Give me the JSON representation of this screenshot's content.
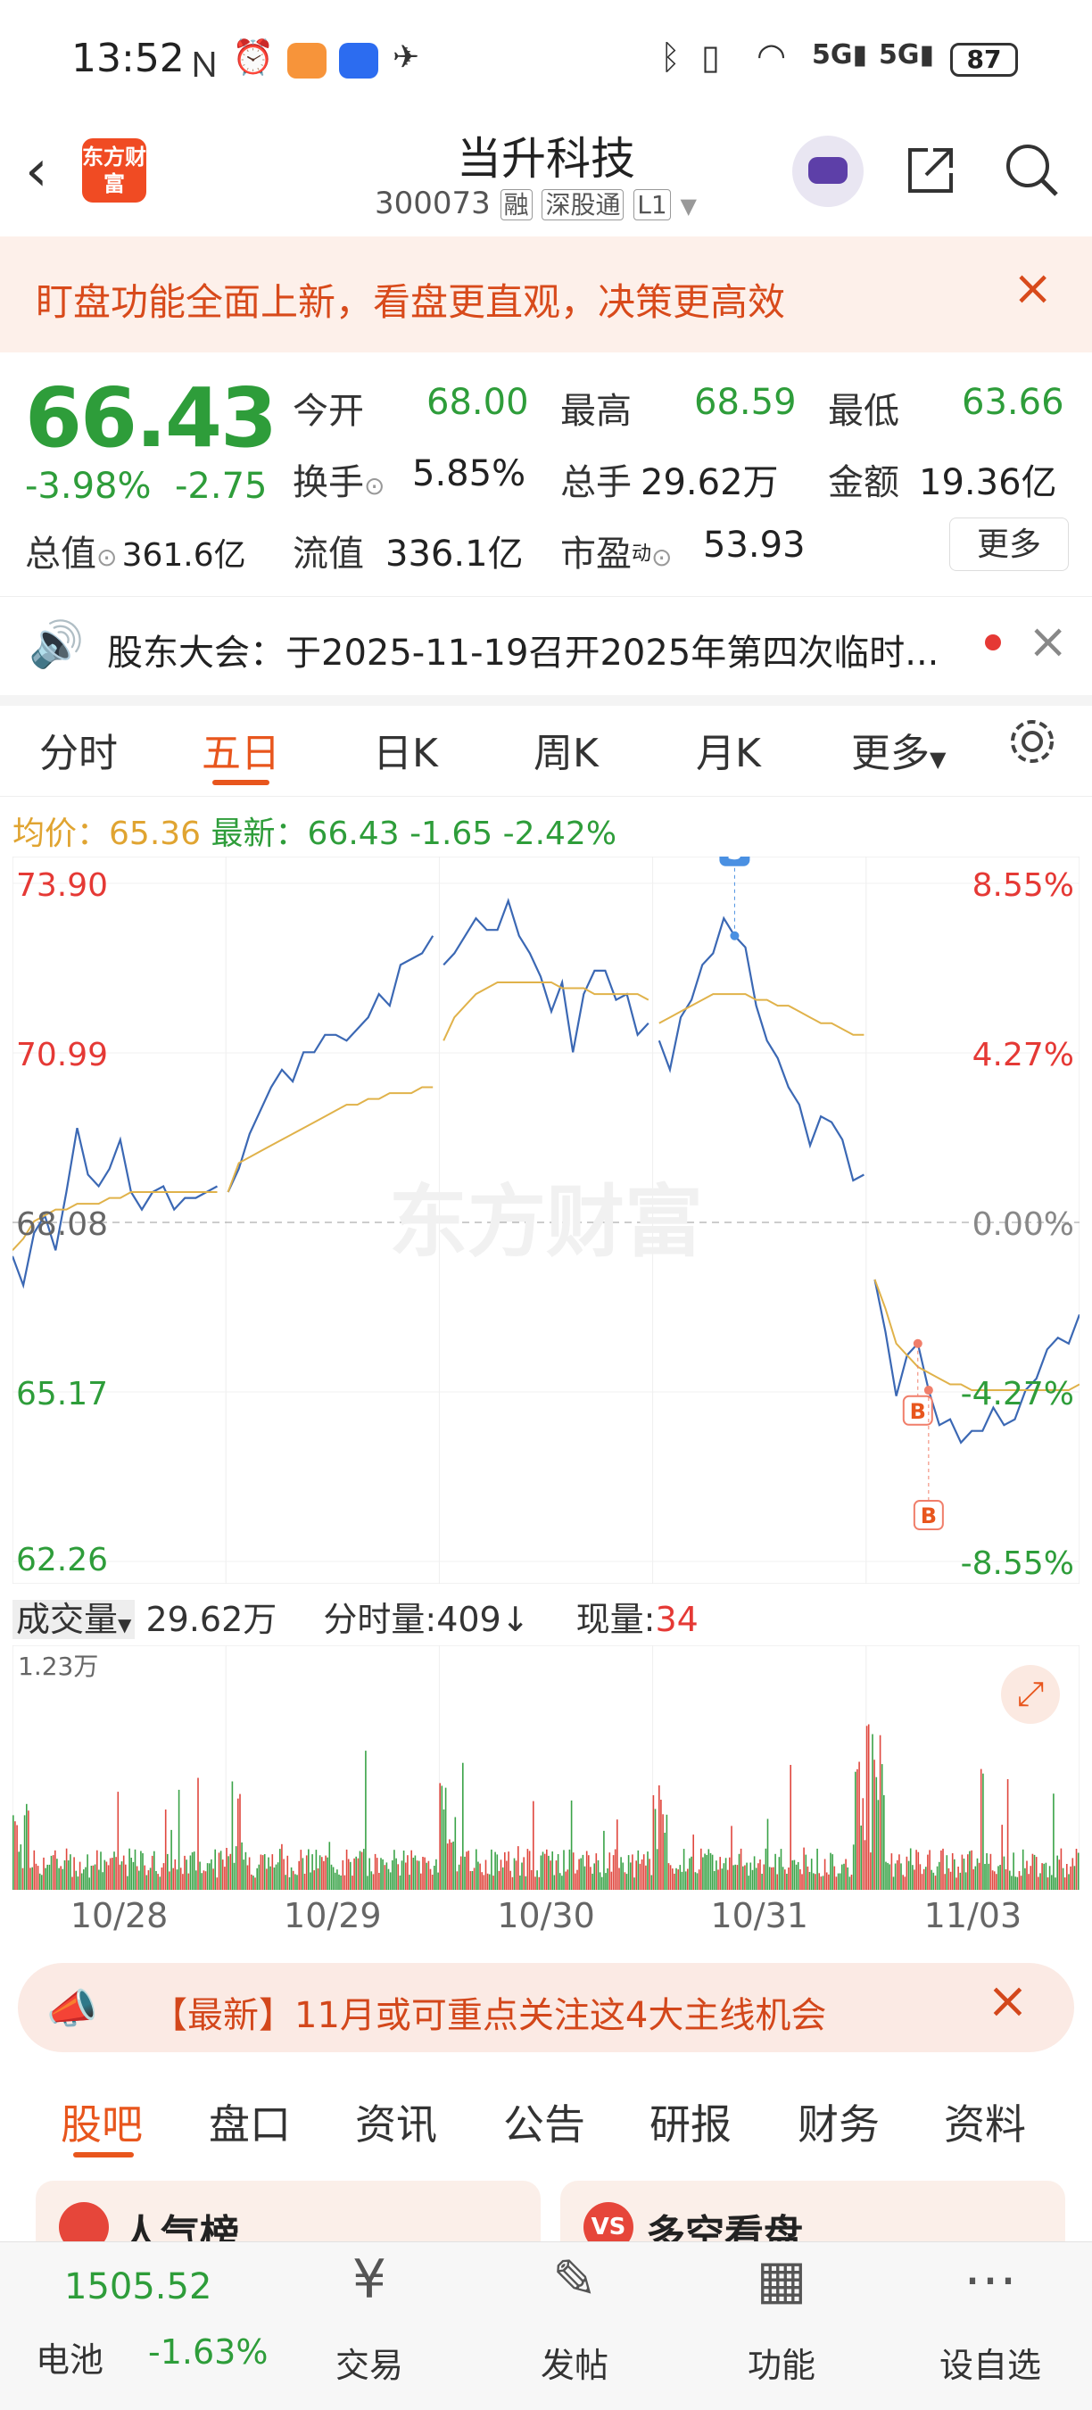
{
  "status_bar": {
    "time": "13:52",
    "battery": "87"
  },
  "header": {
    "logo_text": "东方财富",
    "stock_name": "当升科技",
    "stock_code": "300073",
    "tag_rong": "融",
    "tag_sgt": "深股通",
    "tag_level": "L1"
  },
  "banner": {
    "text": "盯盘功能全面上新，看盘更直观，决策更高效"
  },
  "quote": {
    "price": "66.43",
    "change_pct": "-3.98%",
    "change_amt": "-2.75",
    "open_label": "今开",
    "open": "68.00",
    "high_label": "最高",
    "high": "68.59",
    "low_label": "最低",
    "low": "63.66",
    "turnover_label": "换手",
    "turnover": "5.85%",
    "volume_label": "总手",
    "volume": "29.62万",
    "amount_label": "金额",
    "amount": "19.36亿",
    "mktcap_label": "总值",
    "mktcap": "361.6亿",
    "float_label": "流值",
    "float_cap": "336.1亿",
    "pe_label": "市盈",
    "pe_sup": "动",
    "pe": "53.93",
    "more_button": "更多"
  },
  "notice": {
    "text": "股东大会：于2025-11-19召开2025年第四次临时..."
  },
  "chart_tabs": [
    "分时",
    "五日",
    "日K",
    "周K",
    "月K",
    "更多"
  ],
  "avg_bar": {
    "avg_label": "均价：",
    "avg": "65.36",
    "latest_label": "最新：",
    "latest": "66.43",
    "chg": "-1.65",
    "chg_pct": "-2.42%"
  },
  "volume_bar": {
    "label": "成交量",
    "total": "29.62万",
    "tick_label": "分时量:409",
    "now_label": "现量:",
    "now": "34",
    "max": "1.23万"
  },
  "chart_data": {
    "type": "line",
    "watermark": "东方财富",
    "y_left_ticks": [
      "73.90",
      "70.99",
      "68.08",
      "65.17",
      "62.26"
    ],
    "y_right_ticks": [
      "8.55%",
      "4.27%",
      "0.00%",
      "-4.27%",
      "-8.55%"
    ],
    "ylim": [
      62.26,
      73.9
    ],
    "prev_close": 68.08,
    "x_labels": [
      "10/28",
      "10/29",
      "10/30",
      "10/31",
      "11/03"
    ],
    "series": [
      {
        "name": "最新",
        "color": "#3b68b4",
        "values": [
          67.5,
          67.0,
          67.9,
          68.2,
          67.6,
          68.6,
          69.7,
          68.9,
          68.7,
          69.0,
          69.5,
          68.6,
          68.3,
          68.6,
          68.7,
          68.3,
          68.5,
          68.5,
          68.6,
          68.7,
          68.6,
          69.0,
          69.6,
          70.0,
          70.4,
          70.7,
          70.5,
          71.0,
          71.0,
          71.3,
          71.3,
          71.2,
          71.4,
          71.6,
          72.0,
          71.8,
          72.5,
          72.6,
          72.7,
          73.0,
          72.5,
          72.7,
          73.0,
          73.3,
          73.1,
          73.1,
          73.6,
          73.0,
          72.7,
          72.3,
          71.7,
          72.2,
          71.0,
          72.0,
          72.4,
          72.4,
          71.9,
          72.0,
          71.3,
          71.5,
          71.2,
          70.7,
          71.6,
          71.9,
          72.5,
          72.7,
          73.3,
          73.0,
          72.8,
          71.8,
          71.2,
          70.9,
          70.4,
          70.1,
          69.4,
          69.9,
          69.8,
          69.5,
          68.8,
          68.9,
          67.1,
          66.2,
          65.1,
          65.8,
          66.0,
          65.2,
          64.6,
          64.7,
          64.3,
          64.5,
          64.5,
          64.9,
          64.6,
          64.7,
          65.2,
          65.4,
          65.9,
          66.1,
          66.0,
          66.5
        ]
      },
      {
        "name": "均价",
        "color": "#e0b24a",
        "values": [
          67.6,
          67.8,
          68.1,
          68.2,
          68.3,
          68.3,
          68.4,
          68.4,
          68.4,
          68.5,
          68.5,
          68.6,
          68.6,
          68.6,
          68.6,
          68.6,
          68.6,
          68.6,
          68.6,
          68.6,
          68.6,
          69.1,
          69.2,
          69.3,
          69.4,
          69.5,
          69.6,
          69.7,
          69.8,
          69.9,
          70.0,
          70.1,
          70.1,
          70.2,
          70.2,
          70.3,
          70.3,
          70.3,
          70.4,
          70.4,
          71.2,
          71.6,
          71.8,
          72.0,
          72.1,
          72.2,
          72.2,
          72.2,
          72.2,
          72.2,
          72.2,
          72.1,
          72.1,
          72.1,
          72.0,
          72.0,
          72.0,
          72.0,
          72.0,
          71.9,
          71.5,
          71.6,
          71.7,
          71.8,
          71.9,
          72.0,
          72.0,
          72.0,
          72.0,
          71.9,
          71.9,
          71.8,
          71.8,
          71.7,
          71.6,
          71.5,
          71.5,
          71.4,
          71.3,
          71.3,
          67.1,
          66.6,
          66.0,
          65.8,
          65.6,
          65.5,
          65.4,
          65.3,
          65.3,
          65.2,
          65.2,
          65.2,
          65.2,
          65.2,
          65.2,
          65.2,
          65.2,
          65.2,
          65.2,
          65.3
        ]
      }
    ],
    "annotations": [
      "S",
      "B",
      "B"
    ]
  },
  "news_bar": {
    "text": "【最新】11月或可重点关注这4大主线机会"
  },
  "bottom_tabs": [
    "股吧",
    "盘口",
    "资讯",
    "公告",
    "研报",
    "财务",
    "资料"
  ],
  "cards": {
    "left": "人气榜",
    "right": "多空看盘"
  },
  "bottom_nav": {
    "index_value": "1505.52",
    "index_name": "电池",
    "index_chg": "-1.63%",
    "trade": "交易",
    "post": "发帖",
    "function": "功能",
    "watch": "设自选"
  }
}
